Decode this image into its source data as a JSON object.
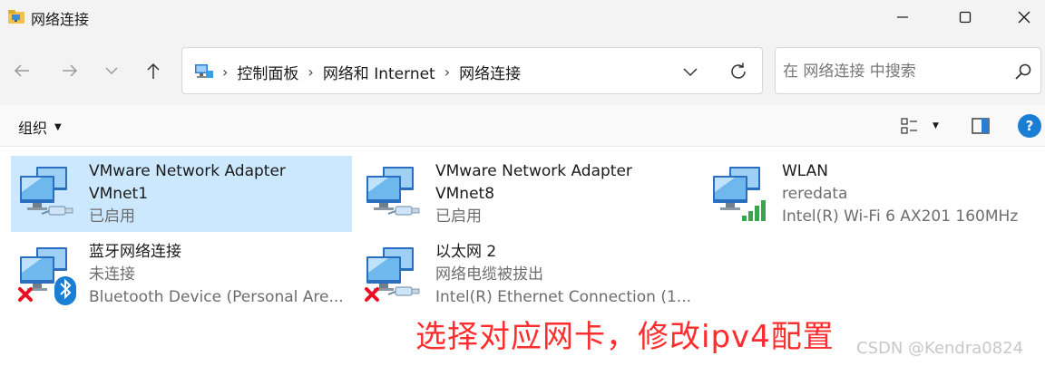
{
  "window": {
    "title": "网络连接",
    "controls": {
      "minimize": "minimize-icon",
      "maximize": "maximize-icon",
      "close": "close-icon"
    }
  },
  "nav": {
    "breadcrumbs": [
      "控制面板",
      "网络和 Internet",
      "网络连接"
    ],
    "search_placeholder": "在 网络连接 中搜索"
  },
  "commandbar": {
    "organize_label": "组织"
  },
  "connections": [
    {
      "name": "VMware Network Adapter",
      "name2": "VMnet1",
      "sub": "已启用",
      "selected": true,
      "status": "enabled"
    },
    {
      "name": "VMware Network Adapter",
      "name2": "VMnet8",
      "sub": "已启用",
      "selected": false,
      "status": "enabled"
    },
    {
      "name": "WLAN",
      "name2": "reredata",
      "sub": "Intel(R) Wi-Fi 6 AX201 160MHz",
      "selected": false,
      "status": "wifi"
    },
    {
      "name": "蓝牙网络连接",
      "name2": "未连接",
      "sub": "Bluetooth Device (Personal Are...",
      "selected": false,
      "status": "disconnected-bluetooth"
    },
    {
      "name": "以太网 2",
      "name2": "网络电缆被拔出",
      "sub": "Intel(R) Ethernet Connection (1...",
      "selected": false,
      "status": "disconnected"
    }
  ],
  "annotation": "选择对应网卡，修改ipv4配置",
  "watermark": "CSDN @Kendra0824",
  "colors": {
    "selection": "#cce8ff",
    "accent": "#1a7fd4",
    "annotation": "#ff2d2d",
    "error": "#e81123"
  }
}
